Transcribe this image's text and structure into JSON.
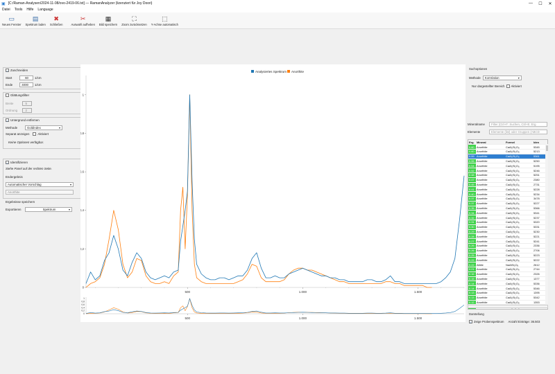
{
  "window": {
    "title": "[C:/Raman-Analysen/2024-11-08/ovo-2419-06.txt] — RamanAnalyzer (lizenziert für Joy Doori)",
    "min": "—",
    "max": "☐",
    "close": "✕"
  },
  "menu": [
    "Datei",
    "Tools",
    "Hilfe",
    "Language"
  ],
  "toolbar": [
    {
      "label": "Neues Fenster",
      "icon": "new-window-icon",
      "glyph": "▭"
    },
    {
      "label": "Spektrum laden",
      "icon": "save-icon",
      "glyph": "▤"
    },
    {
      "label": "Schließen",
      "icon": "close-file-icon",
      "glyph": "✖"
    },
    {
      "label": "Auswahl aufheben",
      "icon": "deselect-icon",
      "glyph": "✂"
    },
    {
      "label": "Bild speichern",
      "icon": "image-save-icon",
      "glyph": "▦"
    },
    {
      "label": "Zoom zurücksetzen",
      "icon": "zoom-reset-icon",
      "glyph": "⛶"
    },
    {
      "label": "Y-Achse automatisch",
      "icon": "y-auto-icon",
      "glyph": "⬚"
    }
  ],
  "left": {
    "crop": {
      "label": "Zuschneiden",
      "checked": true,
      "start_label": "Start",
      "start_val": "60",
      "start_unit": "1/cm",
      "end_label": "Ende",
      "end_val": "4000",
      "end_unit": "1/cm"
    },
    "smooth": {
      "label": "Glättungsfilter",
      "checked": false,
      "width_label": "Breite",
      "width_val": "5",
      "order_label": "Ordnung",
      "order_val": "2"
    },
    "baseline": {
      "label": "Untergrund entfernen",
      "checked": true,
      "method_label": "Methode",
      "method_val": "Goldindex",
      "separate_label": "Separat anzeigen",
      "active_label": "Aktiviert",
      "no_options": "Keine Optionen verfügbar."
    },
    "identify": {
      "label": "Identifizieren",
      "checked": true,
      "hint": "Siehe Panel auf der rechten Seite.",
      "result_label": "Endergebnis",
      "result_combo": "Automatischer Vorschlag",
      "result_value": "Anorthite"
    },
    "export": {
      "title": "Ergebnisse speichern",
      "label": "Exportieren",
      "value": "Spektrum"
    }
  },
  "right": {
    "search_options": "Suchoptionen",
    "method_label": "Methode",
    "method_val": "Korrelation",
    "only_range": "Nur dargestellter Bereich",
    "active_label": "Aktiviert",
    "mineral_label": "Mineralname",
    "mineral_placeholder": "Filter (Ctrl+F: Suchen, Ctrl+E: Erg",
    "elements_label": "Elemente",
    "elements_placeholder": "Elemente (list) oder Gruppen (ABCD",
    "table_headers": [
      "Erg.",
      "Mineral",
      "Formel",
      "Iden"
    ],
    "rows": [
      [
        "0.60",
        "Anorthite",
        "CaAl₂Si₂O₈",
        "5345"
      ],
      [
        "0.60",
        "Anorthite",
        "CaAl₂Si₂O₈",
        "5213"
      ],
      [
        "0.59",
        "Anorthite",
        "CaAl₂Si₂O₈",
        "5361"
      ],
      [
        "0.55",
        "Anorthite",
        "CaAl₂Si₂O₈",
        "5250"
      ],
      [
        "0.54",
        "Anorthite",
        "CaAl₂Si₂O₈",
        "5195"
      ],
      [
        "0.52",
        "Anorthite",
        "CaAl₂Si₂O₈",
        "5246"
      ],
      [
        "0.48",
        "Anorthite",
        "CaAl₂Si₂O₈",
        "5251"
      ],
      [
        "0.47",
        "Anorthite",
        "CaAl₂Si₂O₈",
        "2380"
      ],
      [
        "0.45",
        "Anorthite",
        "CaAl₂Si₂O₈",
        "2731"
      ],
      [
        "0.41",
        "Anorthite",
        "CaAl₂Si₂O₈",
        "5228"
      ],
      [
        "0.40",
        "Anorthite",
        "CaAl₂Si₂O₈",
        "5234"
      ],
      [
        "0.37",
        "Anorthite",
        "CaAl₂Si₂O₈",
        "3478"
      ],
      [
        "0.37",
        "Anorthite",
        "CaAl₂Si₂O₈",
        "5227"
      ],
      [
        "0.35",
        "Anorthite",
        "CaAl₂Si₂O₈",
        "5366"
      ],
      [
        "0.34",
        "Anorthite",
        "CaAl₂Si₂O₈",
        "5341"
      ],
      [
        "0.32",
        "Anorthite",
        "CaAl₂Si₂O₈",
        "5237"
      ],
      [
        "0.31",
        "Anorthite",
        "CaAl₂Si₂O₈",
        "5320"
      ],
      [
        "0.30",
        "Anorthite",
        "CaAl₂Si₂O₈",
        "5331"
      ],
      [
        "0.29",
        "Anorthite",
        "CaAl₂Si₂O₈",
        "5230"
      ],
      [
        "0.28",
        "Anorthite",
        "CaAl₂Si₂O₈",
        "5221"
      ],
      [
        "0.27",
        "Anorthite",
        "CaAl₂Si₂O₈",
        "5241"
      ],
      [
        "0.26",
        "Anorthite",
        "CaAl₂Si₂O₈",
        "2336"
      ],
      [
        "0.26",
        "Anorthite",
        "CaAl₂Si₂O₈",
        "2706"
      ],
      [
        "0.25",
        "Anorthite",
        "CaAl₂Si₂O₈",
        "5223"
      ],
      [
        "0.22",
        "Anorthite",
        "CaAl₂Si₂O₈",
        "5222"
      ],
      [
        "0.22",
        "Albite",
        "NaAlSi₃O₈",
        "2612"
      ],
      [
        "0.21",
        "Anorthite",
        "CaAl₂Si₂O₈",
        "2744"
      ],
      [
        "0.16",
        "Anorthite",
        "CaAl₂Si₂O₈",
        "2326"
      ],
      [
        "0.15",
        "Anorthite",
        "CaAl₂Si₂O₈",
        "1377"
      ],
      [
        "0.14",
        "Anorthite",
        "CaAl₂Si₂O₈",
        "5336"
      ],
      [
        "0.14",
        "Anorthite",
        "CaAl₂Si₂O₈",
        "5346"
      ],
      [
        "0.13",
        "Anorthite",
        "CaAl₂Si₂O₈",
        "1395"
      ],
      [
        "0.13",
        "Anorthite",
        "CaAl₂Si₂O₈",
        "5342"
      ],
      [
        "0.12",
        "Anorthite",
        "CaAl₂Si₂O₈",
        "1353"
      ],
      [
        "0.11",
        "Anorthite",
        "CaAl₂Si₂O₈",
        "2667"
      ]
    ],
    "selected_row": 2,
    "display_label": "Darstellung",
    "show_sample": "Zeige Probenspektrum",
    "entries": "Anzahl Einträge: 36.503"
  },
  "chart_data": {
    "type": "line",
    "legend": [
      "Analysiertes Spektrum",
      "Anorthite"
    ],
    "colors": [
      "#1f77b4",
      "#ff7f0e"
    ],
    "xlim": [
      60,
      1700
    ],
    "ylim": [
      0,
      1.1
    ],
    "x_ticks": [
      "500",
      "1.000",
      "1.500"
    ],
    "y_ticks": [
      "0",
      "0,2",
      "0,4",
      "0,6",
      "0,8",
      "1"
    ],
    "mini_y_ticks": [
      "0",
      "0,2",
      "0,4",
      "0,6",
      "0,8",
      "1"
    ],
    "series": [
      {
        "name": "Analysiertes Spektrum",
        "x": [
          60,
          80,
          100,
          120,
          140,
          160,
          180,
          200,
          220,
          240,
          260,
          280,
          300,
          320,
          340,
          360,
          380,
          400,
          420,
          440,
          460,
          470,
          480,
          490,
          500,
          510,
          520,
          530,
          540,
          560,
          580,
          600,
          620,
          640,
          660,
          680,
          700,
          720,
          740,
          760,
          780,
          800,
          820,
          840,
          860,
          880,
          900,
          920,
          940,
          960,
          980,
          1000,
          1020,
          1040,
          1060,
          1080,
          1100,
          1120,
          1140,
          1160,
          1180,
          1200,
          1220,
          1240,
          1260,
          1280,
          1300,
          1320,
          1340,
          1360,
          1380,
          1400,
          1420,
          1440,
          1460,
          1480,
          1500,
          1520,
          1540,
          1560,
          1580,
          1600,
          1620,
          1640,
          1660,
          1680,
          1700
        ],
        "y": [
          0.02,
          0.08,
          0.04,
          0.06,
          0.14,
          0.18,
          0.27,
          0.2,
          0.09,
          0.06,
          0.13,
          0.18,
          0.15,
          0.08,
          0.05,
          0.04,
          0.05,
          0.06,
          0.05,
          0.08,
          0.09,
          0.24,
          0.32,
          0.4,
          0.5,
          1.0,
          0.55,
          0.25,
          0.12,
          0.07,
          0.05,
          0.04,
          0.04,
          0.05,
          0.05,
          0.04,
          0.05,
          0.06,
          0.06,
          0.09,
          0.15,
          0.18,
          0.1,
          0.05,
          0.05,
          0.06,
          0.05,
          0.05,
          0.07,
          0.08,
          0.09,
          0.1,
          0.09,
          0.08,
          0.07,
          0.06,
          0.06,
          0.05,
          0.05,
          0.04,
          0.04,
          0.03,
          0.03,
          0.03,
          0.03,
          0.04,
          0.04,
          0.03,
          0.03,
          0.04,
          0.06,
          0.03,
          0.03,
          0.02,
          0.02,
          0.02,
          0.02,
          0.02,
          0.02,
          0.02,
          0.02,
          0.03,
          0.05,
          0.08,
          0.15,
          0.35,
          0.58
        ]
      },
      {
        "name": "Anorthite",
        "x": [
          60,
          80,
          100,
          120,
          140,
          160,
          180,
          200,
          220,
          240,
          260,
          280,
          300,
          320,
          340,
          360,
          380,
          400,
          420,
          440,
          460,
          470,
          480,
          490,
          500,
          510,
          520,
          530,
          540,
          560,
          580,
          600,
          620,
          640,
          660,
          680,
          700,
          720,
          740,
          760,
          780,
          800,
          820,
          840,
          860,
          880,
          900,
          920,
          940,
          960,
          980,
          1000,
          1020,
          1040,
          1060,
          1080,
          1100,
          1120,
          1140,
          1160,
          1180,
          1200,
          1220,
          1240,
          1260,
          1280,
          1300,
          1320,
          1340,
          1360,
          1380,
          1400,
          1420,
          1440,
          1460,
          1480,
          1500,
          1520,
          1540,
          1560
        ],
        "y": [
          0.0,
          0.02,
          0.03,
          0.05,
          0.12,
          0.25,
          0.4,
          0.3,
          0.12,
          0.05,
          0.08,
          0.15,
          0.14,
          0.06,
          0.03,
          0.02,
          0.02,
          0.03,
          0.02,
          0.06,
          0.08,
          0.4,
          0.52,
          0.2,
          0.48,
          1.0,
          0.4,
          0.12,
          0.05,
          0.03,
          0.02,
          0.02,
          0.02,
          0.02,
          0.02,
          0.02,
          0.02,
          0.03,
          0.04,
          0.07,
          0.12,
          0.11,
          0.05,
          0.03,
          0.03,
          0.03,
          0.03,
          0.04,
          0.07,
          0.09,
          0.1,
          0.1,
          0.09,
          0.09,
          0.08,
          0.07,
          0.06,
          0.05,
          0.04,
          0.03,
          0.03,
          0.02,
          0.02,
          0.02,
          0.02,
          0.02,
          0.02,
          0.02,
          0.02,
          0.03,
          0.03,
          0.02,
          0.02,
          0.01,
          0.01,
          0.01,
          0.01,
          0.01,
          0.0,
          0.0
        ]
      }
    ]
  }
}
